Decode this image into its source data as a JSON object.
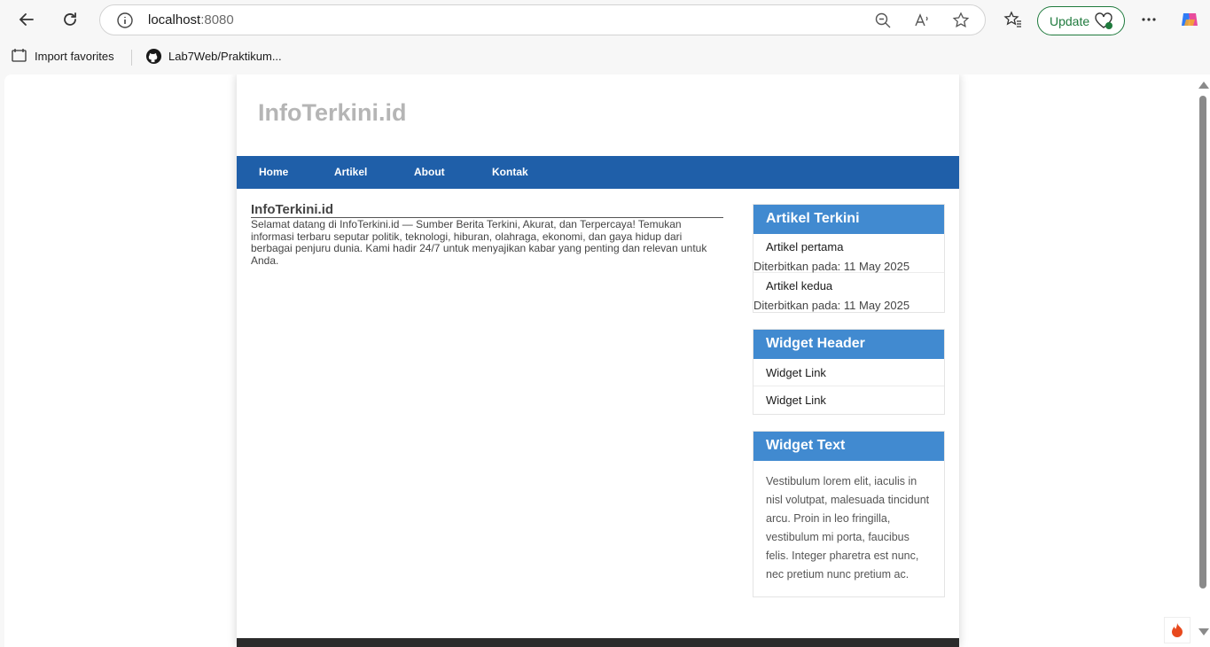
{
  "browser": {
    "url_host": "localhost",
    "url_port": ":8080",
    "update_label": "Update",
    "favorites": [
      {
        "label": "Import favorites",
        "icon": "import-icon"
      },
      {
        "label": "Lab7Web/Praktikum...",
        "icon": "github-icon"
      }
    ]
  },
  "site": {
    "title": "InfoTerkini.id",
    "nav": [
      "Home",
      "Artikel",
      "About",
      "Kontak"
    ]
  },
  "main": {
    "heading": "InfoTerkini.id",
    "text": "Selamat datang di InfoTerkini.id — Sumber Berita Terkini, Akurat, dan Terpercaya! Temukan informasi terbaru seputar politik, teknologi, hiburan, olahraga, ekonomi, dan gaya hidup dari berbagai penjuru dunia. Kami hadir 24/7 untuk menyajikan kabar yang penting dan relevan untuk Anda."
  },
  "sidebar": {
    "articles": {
      "header": "Artikel Terkini",
      "items": [
        {
          "title": "Artikel pertama",
          "date": "Diterbitkan pada: 11 May 2025"
        },
        {
          "title": "Artikel kedua",
          "date": "Diterbitkan pada: 11 May 2025"
        }
      ]
    },
    "links": {
      "header": "Widget Header",
      "items": [
        "Widget Link",
        "Widget Link"
      ]
    },
    "text_widget": {
      "header": "Widget Text",
      "body": "Vestibulum lorem elit, iaculis in nisl volutpat, malesuada tincidunt arcu. Proin in leo fringilla, vestibulum mi porta, faucibus felis. Integer pharetra est nunc, nec pretium nunc pretium ac."
    }
  },
  "colors": {
    "nav_bg": "#1f5fa9",
    "widget_head_bg": "#418ad0",
    "site_title": "#b5b5b5",
    "update_green": "#1f7a3d"
  }
}
